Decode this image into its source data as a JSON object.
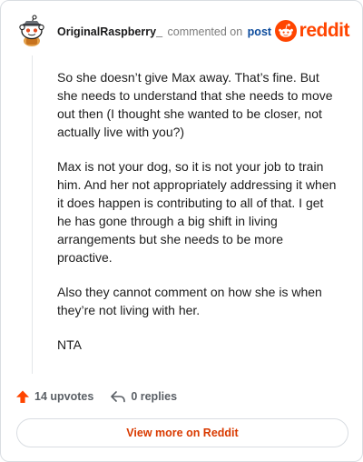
{
  "header": {
    "username": "OriginalRaspberry_",
    "commented_text": "commented on",
    "post_link": "post",
    "brand_word": "reddit",
    "brand_color": "#ff4500"
  },
  "comment": {
    "paragraphs": [
      "So she doesn’t give Max away. That’s fine. But she needs to understand that she needs to move out then (I thought she wanted to be closer, not actually live with you?)",
      "Max is not your dog, so it is not your job to train him. And her not appropriately addressing it when it does happen is contributing to all of that. I get he has gone through a big shift in living arrangements but she needs to be more proactive.",
      "Also they cannot comment on how she is when they’re not living with her.",
      "NTA"
    ]
  },
  "actions": {
    "upvotes_label": "14 upvotes",
    "replies_label": "0 replies",
    "upvote_icon": "upvote-arrow-icon",
    "reply_icon": "reply-arrow-icon"
  },
  "footer": {
    "view_more_label": "View more on Reddit",
    "accent_color": "#d93a00"
  }
}
